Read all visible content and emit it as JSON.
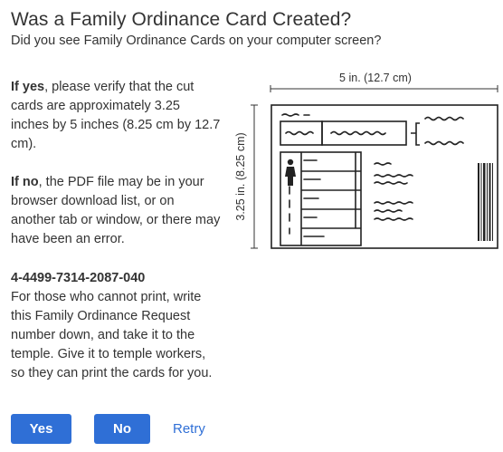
{
  "title": "Was a Family Ordinance Card Created?",
  "subtitle": "Did you see Family Ordinance Cards on your computer screen?",
  "yes_block": {
    "lead": "If yes",
    "text": ", please verify that the cut cards are approximately 3.25 inches by 5 inches (8.25 cm by 12.7 cm)."
  },
  "no_block": {
    "lead": "If no",
    "text": ", the PDF file may be in your browser download list, or on another tab or window, or there may have been an error."
  },
  "request": {
    "number": "4-4499-7314-2087-040",
    "text": "For those who cannot print, write this Family Ordinance Request number down, and take it to the temple. Give it to temple workers, so they can print the cards for you."
  },
  "diagram": {
    "width_label": "5 in. (12.7 cm)",
    "height_label": "3.25 in. (8.25 cm)",
    "icons": [
      "person-icon",
      "barcode-icon"
    ]
  },
  "buttons": {
    "yes": "Yes",
    "no": "No",
    "retry": "Retry"
  },
  "colors": {
    "primary": "#2f6fd6",
    "text": "#333333"
  }
}
